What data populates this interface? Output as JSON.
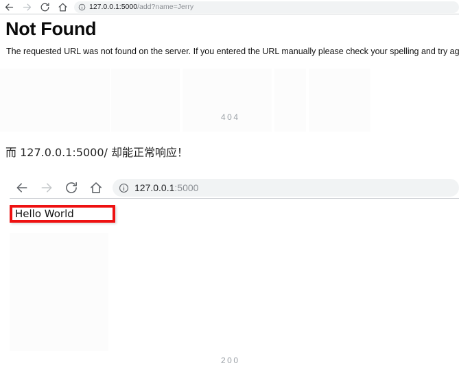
{
  "browser_top": {
    "back_icon": "back-arrow-icon",
    "forward_icon": "forward-arrow-icon",
    "reload_icon": "reload-icon",
    "home_icon": "home-icon",
    "info_icon": "info-circle-icon",
    "url_host": "127.0.0.1:5000",
    "url_path": "/add?name=Jerry",
    "url_full": "127.0.0.1:5000/add?name=Jerry"
  },
  "error_page": {
    "title": "Not Found",
    "message": "The requested URL was not found on the server. If you entered the URL manually please check your spelling and try again.",
    "status_code": "404"
  },
  "annotation": {
    "text": "而 127.0.0.1:5000/ 却能正常响应！"
  },
  "browser_inner": {
    "back_icon": "back-arrow-icon",
    "forward_icon": "forward-arrow-icon",
    "reload_icon": "reload-icon",
    "home_icon": "home-icon",
    "info_icon": "info-circle-icon",
    "url_host": "127.0.0.1",
    "url_port": ":5000",
    "url_full": "127.0.0.1:5000"
  },
  "success_page": {
    "body_text": "Hello World",
    "status_code": "200",
    "highlight_color": "#ee1111"
  },
  "colors": {
    "omnibox_background": "#f1f3f4",
    "url_dim_text": "#8b8f94",
    "url_text": "#202124",
    "watermark_text": "#9aa0a6",
    "separator": "#c9ccd0",
    "icon_active": "#5f6368",
    "icon_disabled": "#bdc1c6"
  }
}
